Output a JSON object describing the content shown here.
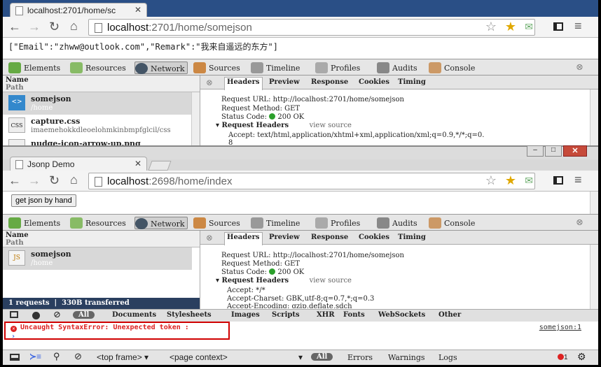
{
  "w1": {
    "tab_title": "localhost:2701/home/sc",
    "url_host": "localhost",
    "url_rest": ":2701/home/somejson",
    "body_text": "[\"Email\":\"zhww@outlook.com\",\"Remark\":\"我来自遥远的东方\"]"
  },
  "w2": {
    "tab_title": "Jsonp Demo",
    "url_host": "localhost",
    "url_rest": ":2698/home/index",
    "button_label": "get json by hand"
  },
  "devtabs": [
    "Elements",
    "Resources",
    "Network",
    "Sources",
    "Timeline",
    "Profiles",
    "Audits",
    "Console"
  ],
  "net": {
    "col_name": "Name",
    "col_path": "Path",
    "panel_tabs": [
      "Headers",
      "Preview",
      "Response",
      "Cookies",
      "Timing"
    ],
    "view_source": "view source"
  },
  "p1": {
    "items": [
      {
        "name": "somejson",
        "path": "/home",
        "icon": "<>"
      },
      {
        "name": "capture.css",
        "path": "imaemehokkdleoelohmkinbmpfglcil/css",
        "icon": "CSS"
      },
      {
        "name": "nudge-icon-arrow-up.png"
      }
    ],
    "lines": {
      "url": "Request URL: http://localhost:2701/home/somejson",
      "method": "Request Method: GET",
      "status_label": "Status Code:",
      "status": "200 OK",
      "req_headers": "Request Headers",
      "accept": "Accept: text/html,application/xhtml+xml,application/xml;q=0.9,*/*;q=0.",
      "accept_cont": "8"
    }
  },
  "p2": {
    "items": [
      {
        "name": "somejson",
        "path": "/home",
        "icon": "JS"
      }
    ],
    "summary": "1 requests  |  330B transferred",
    "lines": {
      "url": "Request URL: http://localhost:2701/home/somejson",
      "method": "Request Method: GET",
      "status_label": "Status Code:",
      "status": "200 OK",
      "req_headers": "Request Headers",
      "accept": "Accept: */*",
      "charset": "Accept-Charset: GBK,utf-8;q=0.7,*;q=0.3",
      "encoding": "Accept-Encoding: gzip,deflate,sdch"
    }
  },
  "filters": {
    "all": "All",
    "items": [
      "Documents",
      "Stylesheets",
      "Images",
      "Scripts",
      "XHR",
      "Fonts",
      "WebSockets",
      "Other"
    ]
  },
  "console": {
    "error": "Uncaught SyntaxError: Unexpected token :",
    "source": "somejson:1",
    "prompt": "›"
  },
  "status": {
    "frame": "<top frame>",
    "context": "<page context>",
    "all": "All",
    "errors": "Errors",
    "warnings": "Warnings",
    "logs": "Logs",
    "error_count": "1"
  },
  "colors": {
    "status_ok": "#2ca02c",
    "error_red": "#d22",
    "highlight_border": "#d00000",
    "chrome_blue": "#2a4f86"
  }
}
